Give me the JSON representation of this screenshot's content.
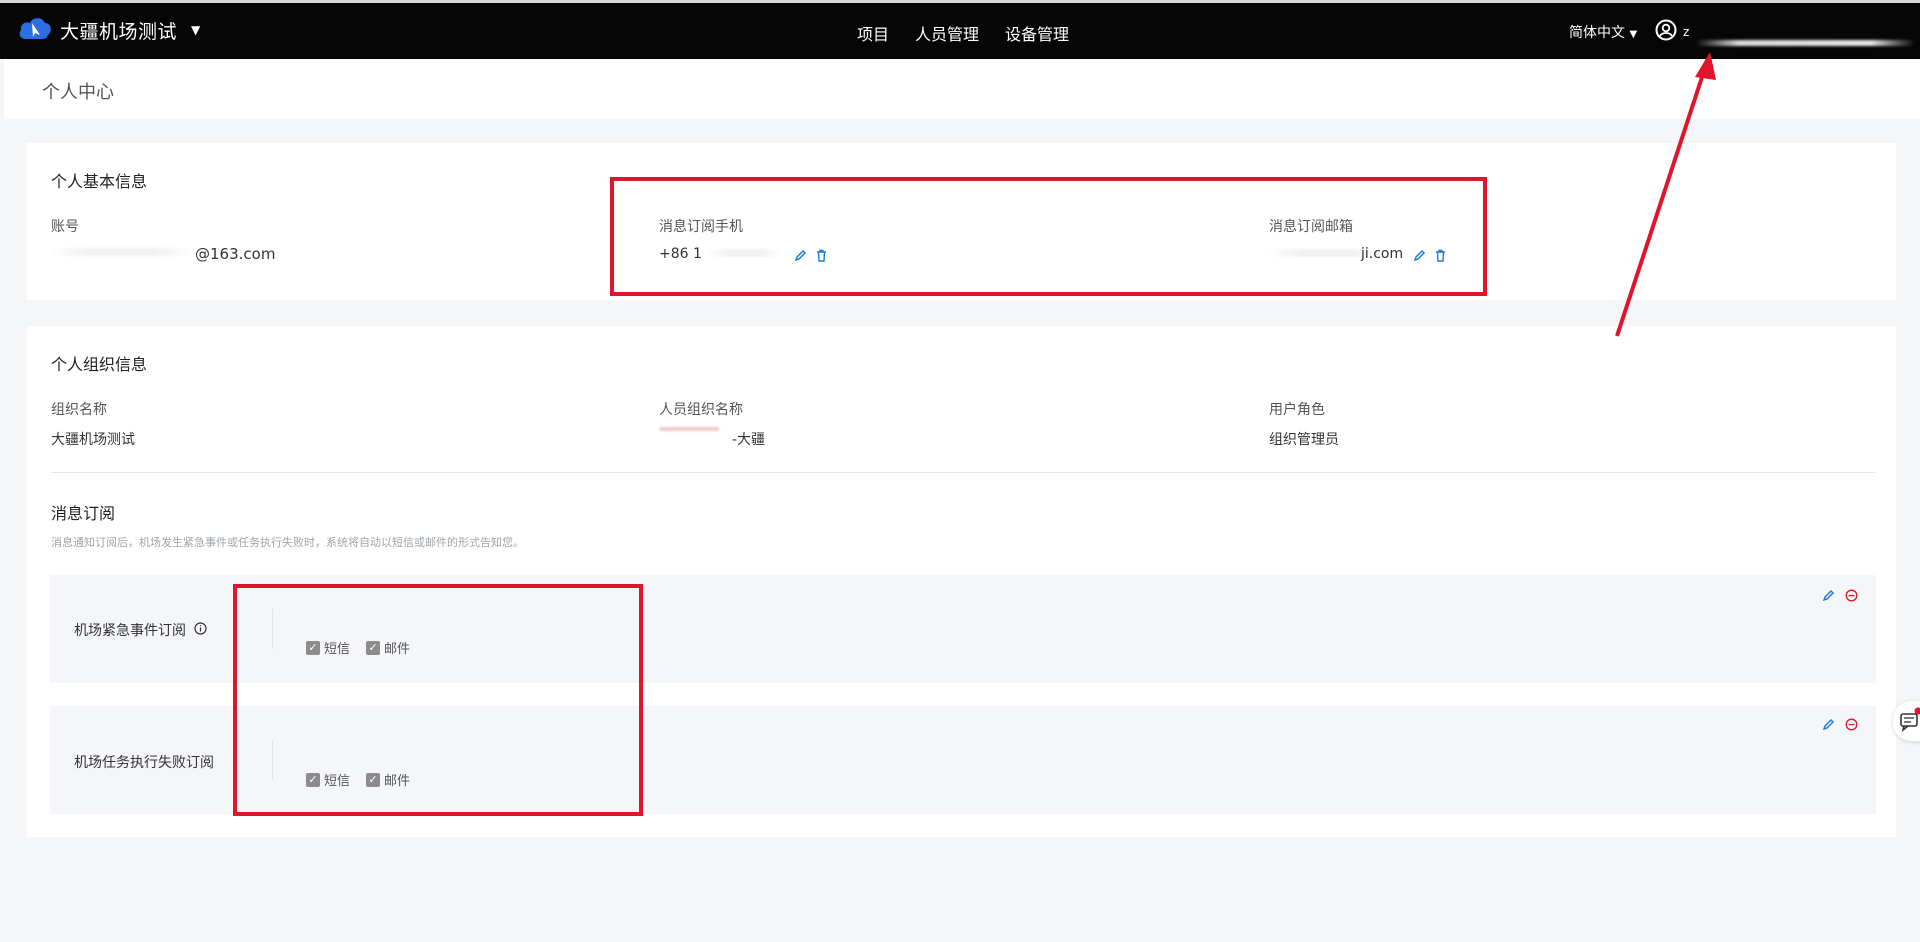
{
  "header": {
    "app_name": "大疆机场测试",
    "nav": [
      "项目",
      "人员管理",
      "设备管理"
    ],
    "language": "简体中文",
    "user_initial": "z"
  },
  "page": {
    "title": "个人中心"
  },
  "basic_info": {
    "title": "个人基本信息",
    "account_label": "账号",
    "account_value": "@163.com",
    "phone_label": "消息订阅手机",
    "phone_value": "+86 1",
    "email_label": "消息订阅邮箱",
    "email_value": "ji.com"
  },
  "org_info": {
    "title": "个人组织信息",
    "org_name_label": "组织名称",
    "org_name_value": "大疆机场测试",
    "member_org_label": "人员组织名称",
    "member_org_value": "-大疆",
    "role_label": "用户角色",
    "role_value": "组织管理员"
  },
  "subscription": {
    "title": "消息订阅",
    "description": "消息通知订阅后，机场发生紧急事件或任务执行失败时，系统将自动以短信或邮件的形式告知您。",
    "rows": [
      {
        "name": "机场紧急事件订阅",
        "sms": "短信",
        "mail": "邮件"
      },
      {
        "name": "机场任务执行失败订阅",
        "sms": "短信",
        "mail": "邮件"
      }
    ]
  },
  "colors": {
    "topbar": "#060606",
    "accent": "#1f7cd6",
    "danger": "#e0142b",
    "annotation": "#e0142b"
  }
}
